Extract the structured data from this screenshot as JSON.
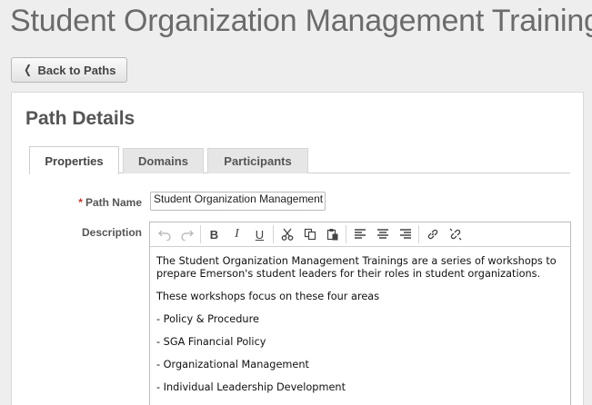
{
  "page": {
    "title": "Student Organization Management Training",
    "back_label": "Back to Paths"
  },
  "panel": {
    "title": "Path Details",
    "tabs": [
      {
        "label": "Properties",
        "active": true
      },
      {
        "label": "Domains",
        "active": false
      },
      {
        "label": "Participants",
        "active": false
      }
    ]
  },
  "form": {
    "required_marker": "*",
    "path_name_label": "Path Name",
    "path_name_value": "Student Organization Management Training",
    "description_label": "Description"
  },
  "editor": {
    "toolbar_icons": [
      "undo-icon",
      "redo-icon",
      "bold-icon",
      "italic-icon",
      "underline-icon",
      "cut-icon",
      "copy-icon",
      "paste-icon",
      "align-left-icon",
      "align-center-icon",
      "align-right-icon",
      "link-icon",
      "unlink-icon"
    ],
    "toolbar_text": {
      "bold": "B",
      "italic": "I",
      "underline": "U"
    },
    "paragraphs": [
      "The Student Organization Management Trainings are a series of workshops to prepare Emerson's student leaders for their roles in student organizations.",
      "These workshops focus on these four areas",
      "- Policy & Procedure",
      "- SGA Financial Policy",
      "- Organizational Management",
      "- Individual Leadership Development"
    ]
  },
  "colors": {
    "required": "#c0392b",
    "background": "#eeeeee",
    "panel": "#ffffff"
  }
}
